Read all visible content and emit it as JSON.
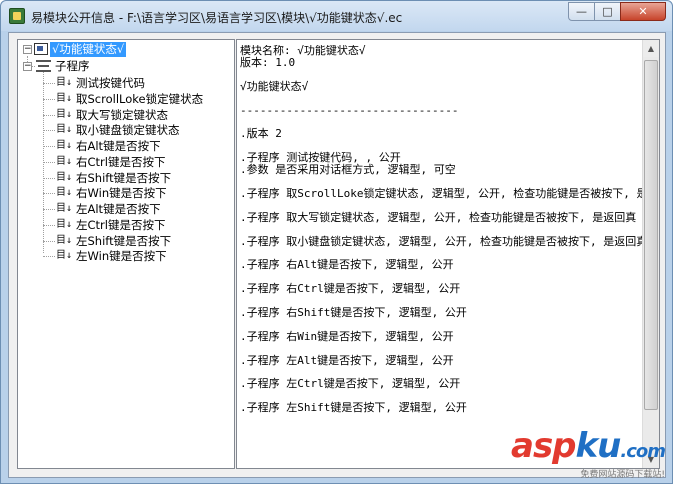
{
  "window": {
    "title": "易模块公开信息 - F:\\语言学习区\\易语言学习区\\模块\\√功能键状态√.ec",
    "buttons": {
      "minimize": "—",
      "maximize": "□",
      "close": "✕"
    }
  },
  "tree": {
    "root": {
      "label": "√功能键状态√",
      "toggle": "−"
    },
    "group": {
      "label": "子程序",
      "toggle": "−"
    },
    "items": [
      {
        "label": "测试按键代码"
      },
      {
        "label": "取ScrollLoke锁定键状态"
      },
      {
        "label": "取大写锁定键状态"
      },
      {
        "label": "取小键盘锁定键状态"
      },
      {
        "label": "右Alt键是否按下"
      },
      {
        "label": "右Ctrl键是否按下"
      },
      {
        "label": "右Shift键是否按下"
      },
      {
        "label": "右Win键是否按下"
      },
      {
        "label": "左Alt键是否按下"
      },
      {
        "label": "左Ctrl键是否按下"
      },
      {
        "label": "左Shift键是否按下"
      },
      {
        "label": "左Win键是否按下"
      }
    ],
    "item_icon_text": "目↓"
  },
  "content": {
    "text": "模块名称: √功能键状态√\n版本: 1.0\n\n√功能键状态√\n\n---------------------------------\n\n.版本 2\n\n.子程序 测试按键代码, , 公开\n.参数 是否采用对话框方式, 逻辑型, 可空\n\n.子程序 取ScrollLoke锁定键状态, 逻辑型, 公开, 检查功能键是否被按下, 是返回真\n\n.子程序 取大写锁定键状态, 逻辑型, 公开, 检查功能键是否被按下, 是返回真\n\n.子程序 取小键盘锁定键状态, 逻辑型, 公开, 检查功能键是否被按下, 是返回真\n\n.子程序 右Alt键是否按下, 逻辑型, 公开\n\n.子程序 右Ctrl键是否按下, 逻辑型, 公开\n\n.子程序 右Shift键是否按下, 逻辑型, 公开\n\n.子程序 右Win键是否按下, 逻辑型, 公开\n\n.子程序 左Alt键是否按下, 逻辑型, 公开\n\n.子程序 左Ctrl键是否按下, 逻辑型, 公开\n\n.子程序 左Shift键是否按下, 逻辑型, 公开"
  },
  "watermark": {
    "part_a": "asp",
    "part_b": "ku",
    "tld": ".com",
    "sub": "免费网站源码下载站!"
  }
}
